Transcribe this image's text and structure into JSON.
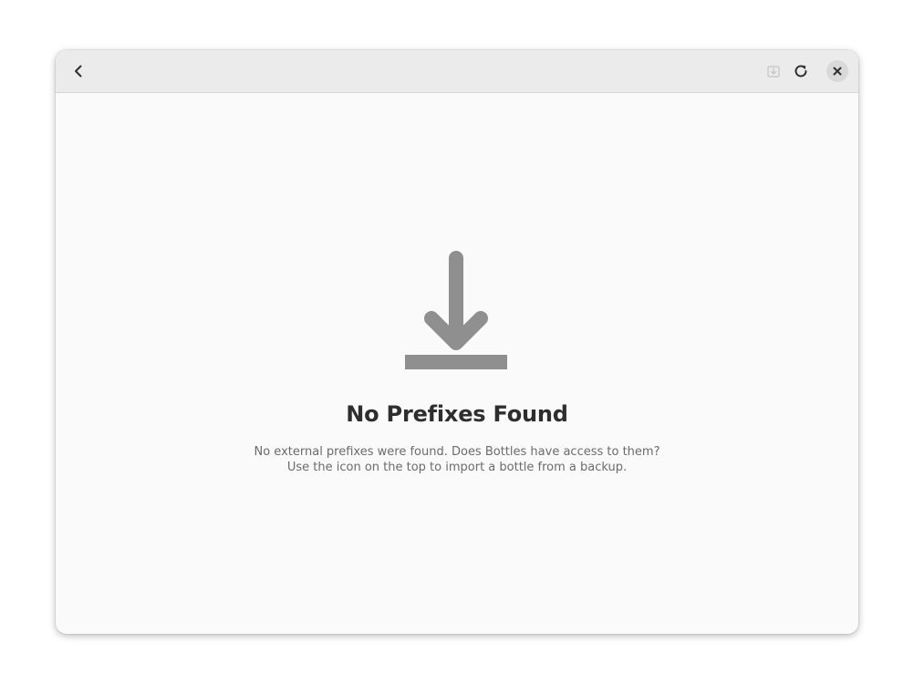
{
  "headerbar": {
    "back_icon": "go-previous-symbolic",
    "import_icon": "document-import-symbolic",
    "refresh_icon": "view-refresh-symbolic",
    "close_icon": "window-close-symbolic"
  },
  "status_page": {
    "icon": "download-symbolic",
    "title": "No Prefixes Found",
    "description_line1": "No external prefixes were found. Does Bottles have access to them?",
    "description_line2": "Use the icon on the top to import a bottle from a backup."
  },
  "colors": {
    "window_bg": "#fafafa",
    "headerbar_bg": "#ebebeb",
    "icon_gray": "#8f8f8f",
    "title_text": "#2e2e2e",
    "desc_text": "#6b6b6b"
  }
}
